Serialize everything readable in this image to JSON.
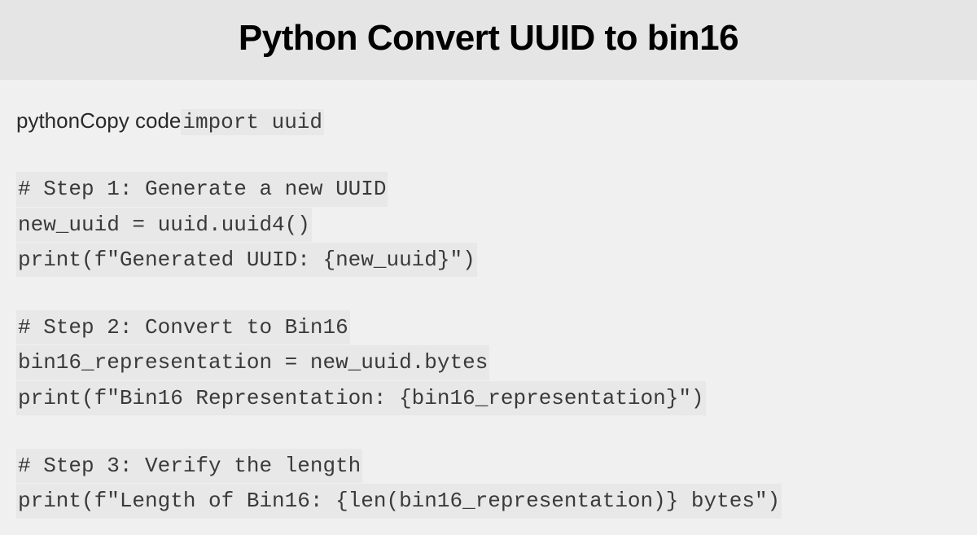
{
  "header": {
    "title": "Python Convert UUID to bin16"
  },
  "code": {
    "label_prefix": "pythonCopy code",
    "line1": "import uuid",
    "line2": "# Step 1: Generate a new UUID",
    "line3": "new_uuid = uuid.uuid4()",
    "line4": "print(f\"Generated UUID: {new_uuid}\")",
    "line5": "# Step 2: Convert to Bin16",
    "line6": "bin16_representation = new_uuid.bytes",
    "line7": "print(f\"Bin16 Representation: {bin16_representation}\")",
    "line8": "# Step 3: Verify the length",
    "line9": "print(f\"Length of Bin16: {len(bin16_representation)} bytes\")"
  }
}
